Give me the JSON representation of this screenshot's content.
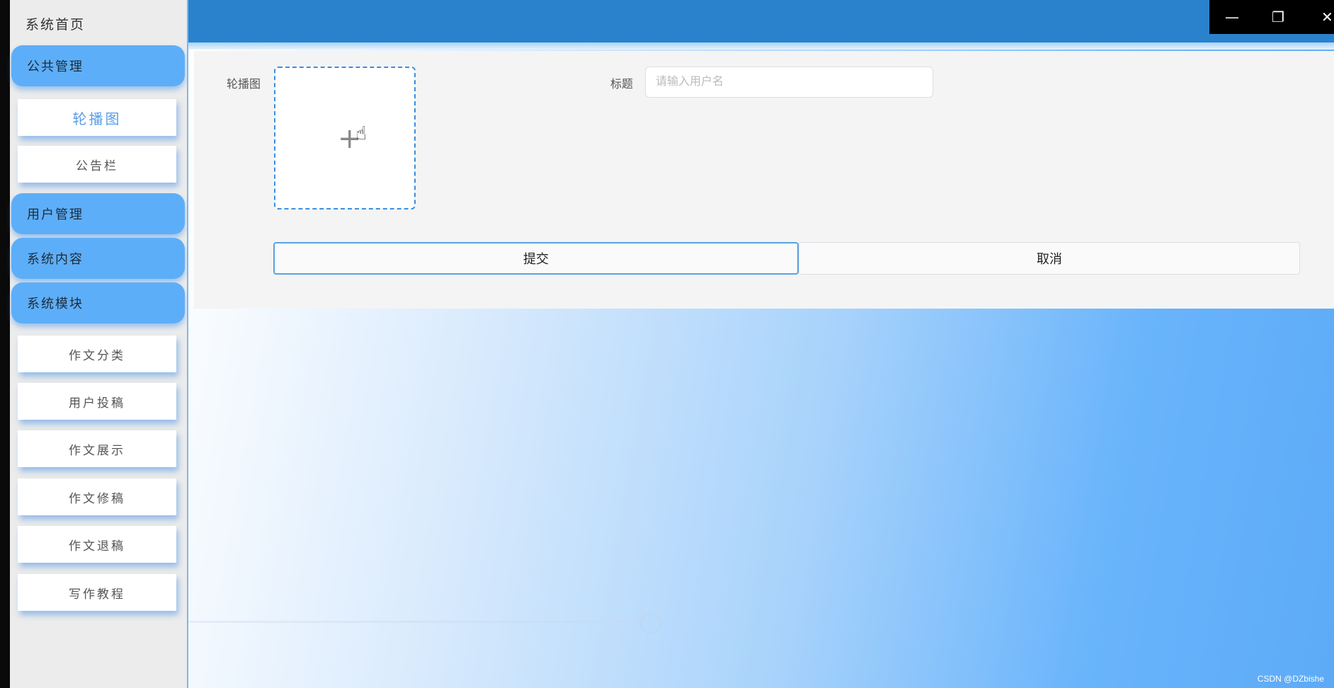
{
  "sidebar": {
    "home": "系统首页",
    "groups": {
      "public": "公共管理",
      "user": "用户管理",
      "content": "系统内容",
      "module": "系统模块"
    },
    "public_items": [
      "轮播图",
      "公告栏"
    ],
    "module_items": [
      "作文分类",
      "用户投稿",
      "作文展示",
      "作文修稿",
      "作文退稿",
      "写作教程"
    ]
  },
  "window_controls": {
    "minimize": "—",
    "restore": "❐",
    "close": "✕"
  },
  "form": {
    "carousel_label": "轮播图",
    "title_label": "标题",
    "title_value": "",
    "title_placeholder": "请输入用户名",
    "submit_label": "提交",
    "cancel_label": "取消"
  },
  "watermark": "CSDN @DZbishe",
  "colors": {
    "accent": "#2a82cd",
    "sidebar_button": "#5daef8",
    "upload_border": "#3a8fde"
  }
}
